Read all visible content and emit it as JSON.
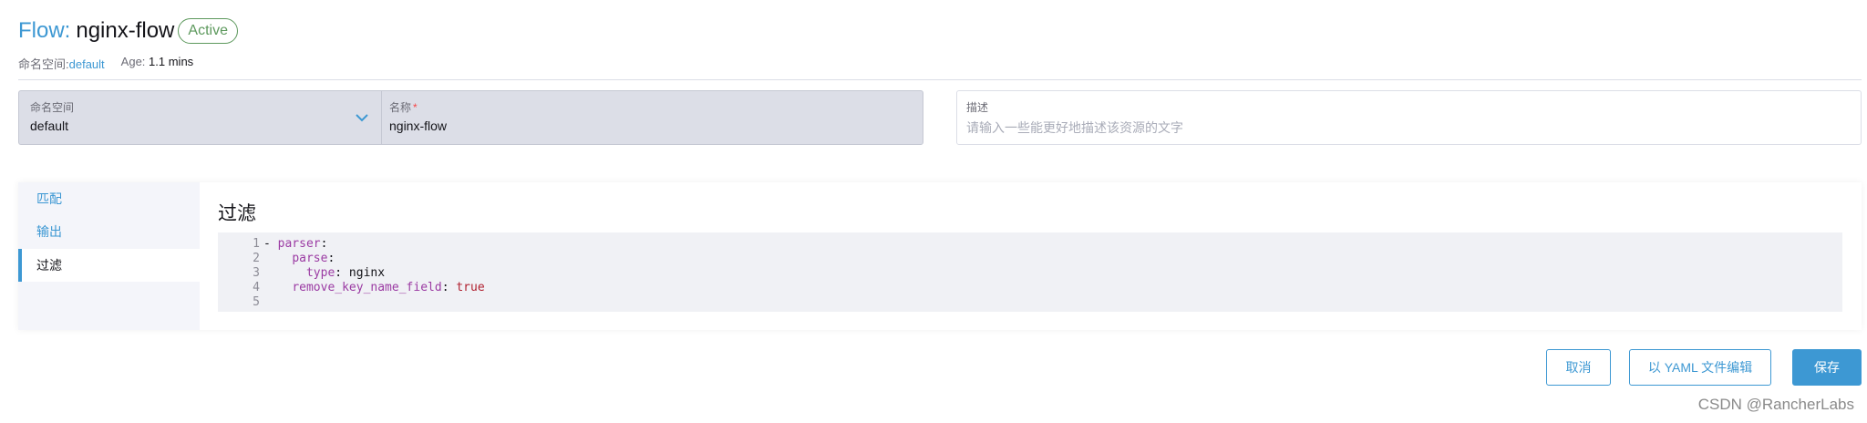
{
  "header": {
    "prefix": "Flow:",
    "name": "nginx-flow",
    "status": "Active",
    "namespace_label": "命名空间:",
    "namespace_value": "default",
    "age_label": "Age:",
    "age_value": "1.1 mins"
  },
  "form": {
    "namespace": {
      "label": "命名空间",
      "value": "default"
    },
    "name": {
      "label": "名称",
      "required_mark": "*",
      "value": "nginx-flow"
    },
    "description": {
      "label": "描述",
      "placeholder": "请输入一些能更好地描述该资源的文字"
    }
  },
  "sidebar": {
    "items": [
      {
        "label": "匹配",
        "active": false
      },
      {
        "label": "输出",
        "active": false
      },
      {
        "label": "过滤",
        "active": true
      }
    ]
  },
  "content": {
    "title": "过滤",
    "code_lines": [
      {
        "num": "1",
        "text": "- parser:"
      },
      {
        "num": "2",
        "text": "    parse:"
      },
      {
        "num": "3",
        "text": "      type: nginx"
      },
      {
        "num": "4",
        "text": "    remove_key_name_field: true"
      },
      {
        "num": "5",
        "text": ""
      }
    ]
  },
  "footer": {
    "cancel": "取消",
    "edit_yaml": "以 YAML 文件编辑",
    "save": "保存"
  },
  "watermark": "CSDN @RancherLabs",
  "colors": {
    "accent": "#3d98d3",
    "active_badge": "#5d995d",
    "required": "#f64747"
  },
  "icons": {
    "namespace_dropdown": "chevron-down-icon"
  }
}
